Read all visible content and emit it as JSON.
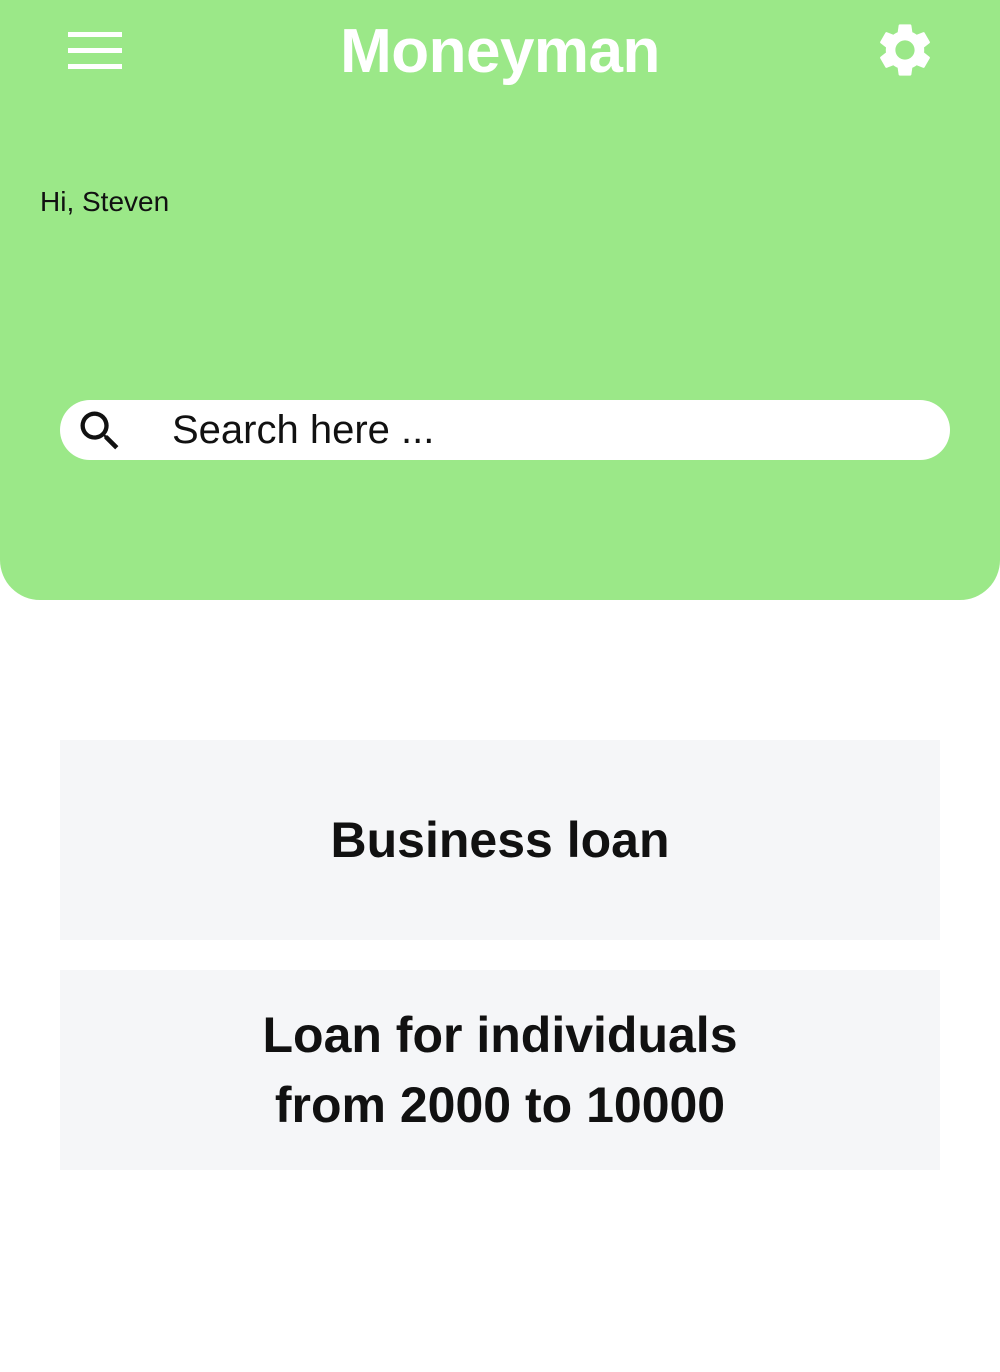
{
  "colors": {
    "header_bg": "#9be888",
    "card_bg": "#f5f6f8",
    "title_text": "#ffffff",
    "body_text": "#111111"
  },
  "header": {
    "title": "Moneyman",
    "menu_icon": "hamburger-menu-icon",
    "settings_icon": "gear-icon"
  },
  "greeting": "Hi, Steven",
  "search": {
    "placeholder": "Search here ...",
    "value": "",
    "icon": "search-icon"
  },
  "cards": [
    {
      "line1": "Business loan"
    },
    {
      "line1": "Loan for individuals",
      "line2": "from 2000 to 10000"
    }
  ]
}
